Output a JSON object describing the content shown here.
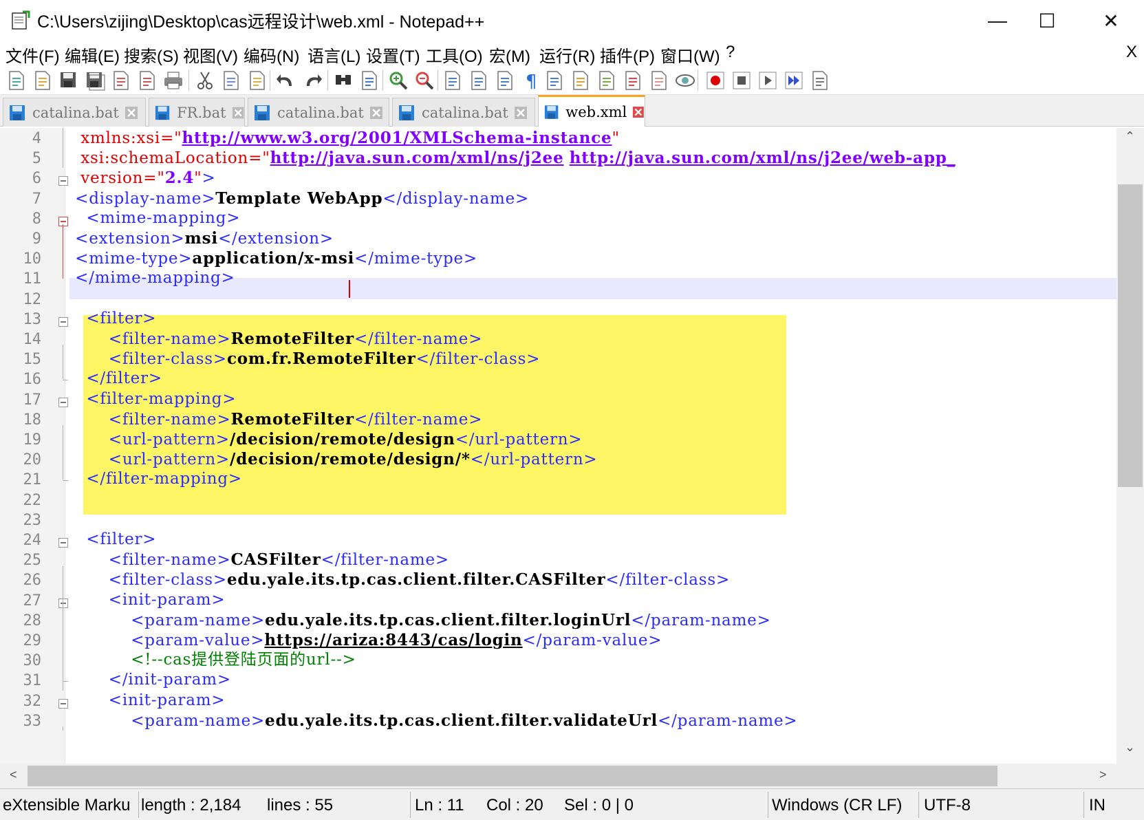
{
  "window": {
    "title": "C:\\Users\\zijing\\Desktop\\cas远程设计\\web.xml - Notepad++",
    "minimize_glyph": "—",
    "maximize_glyph": "☐",
    "close_glyph": "✕"
  },
  "menu": {
    "items": [
      "文件(F)",
      "编辑(E)",
      "搜索(S)",
      "视图(V)",
      "编码(N)",
      "语言(L)",
      "设置(T)",
      "工具(O)",
      "宏(M)",
      "运行(R)",
      "插件(P)",
      "窗口(W)",
      "?"
    ],
    "close_label": "X"
  },
  "toolbar": {
    "icons": [
      "new-file-icon",
      "open-file-icon",
      "save-icon",
      "save-all-icon",
      "close-icon",
      "close-all-icon",
      "print-icon",
      "cut-icon",
      "copy-icon",
      "paste-icon",
      "undo-icon",
      "redo-icon",
      "find-icon",
      "replace-icon",
      "zoom-in-icon",
      "zoom-out-icon",
      "sync-vertical-icon",
      "sync-horizontal-icon",
      "word-wrap-icon",
      "show-all-chars-icon",
      "indent-guide-icon",
      "udl-icon",
      "doc-map-icon",
      "function-list-icon",
      "folder-as-workspace-icon",
      "monitoring-icon",
      "record-macro-icon",
      "stop-macro-icon",
      "play-macro-icon",
      "run-macro-multiple-icon",
      "save-macro-icon"
    ]
  },
  "tabs": [
    {
      "label": "catalina.bat",
      "active": false
    },
    {
      "label": "FR.bat",
      "active": false
    },
    {
      "label": "catalina.bat",
      "active": false
    },
    {
      "label": "catalina.bat",
      "active": false
    },
    {
      "label": "web.xml",
      "active": true
    }
  ],
  "editor": {
    "line_numbers": [
      "4",
      "5",
      "6",
      "7",
      "8",
      "9",
      "10",
      "11",
      "12",
      "13",
      "14",
      "15",
      "16",
      "17",
      "18",
      "19",
      "20",
      "21",
      "22",
      "23",
      "24",
      "25",
      "26",
      "27",
      "28",
      "29",
      "30",
      "31",
      "32",
      "33"
    ],
    "lines": {
      "l4": {
        "indent": "  ",
        "a1": "xmlns:xsi",
        "eq": "=\"",
        "link": "http://www.w3.org/2001/XMLSchema-instance",
        "q": "\""
      },
      "l5": {
        "indent": "  ",
        "a1": "xsi:schemaLocation",
        "eq": "=\"",
        "link1": "http://java.sun.com/xml/ns/j2ee",
        "sp": " ",
        "link2": "http://java.sun.com/xml/ns/j2ee/web-app_"
      },
      "l6": {
        "indent": "  ",
        "a1": "version",
        "eq": "=\"",
        "val": "2.4",
        "q": "\"",
        "close": ">"
      },
      "l7": {
        "indent": " ",
        "open": "<display-name>",
        "text": "Template WebApp",
        "close": "</display-name>"
      },
      "l8": {
        "indent": "   ",
        "open": "<mime-mapping>"
      },
      "l9": {
        "indent": " ",
        "open": "<extension>",
        "text": "msi",
        "close": "</extension>"
      },
      "l10": {
        "indent": " ",
        "open": "<mime-type>",
        "text": "application/x-msi",
        "close": "</mime-type>"
      },
      "l11": {
        "indent": " ",
        "open": "</mime-mapping>"
      },
      "l13": {
        "indent": "   ",
        "open": "<filter>"
      },
      "l14": {
        "indent": "       ",
        "open": "<filter-name>",
        "text": "RemoteFilter",
        "close": "</filter-name>"
      },
      "l15": {
        "indent": "       ",
        "open": "<filter-class>",
        "text": "com.fr.RemoteFilter",
        "close": "</filter-class>"
      },
      "l16": {
        "indent": "   ",
        "open": "</filter>"
      },
      "l17": {
        "indent": "   ",
        "open": "<filter-mapping>"
      },
      "l18": {
        "indent": "       ",
        "open": "<filter-name>",
        "text": "RemoteFilter",
        "close": "</filter-name>"
      },
      "l19": {
        "indent": "       ",
        "open": "<url-pattern>",
        "text": "/decision/remote/design",
        "close": "</url-pattern>"
      },
      "l20": {
        "indent": "       ",
        "open": "<url-pattern>",
        "text": "/decision/remote/design/*",
        "close": "</url-pattern>"
      },
      "l21": {
        "indent": "   ",
        "open": "</filter-mapping>"
      },
      "l24": {
        "indent": "   ",
        "open": "<filter>"
      },
      "l25": {
        "indent": "       ",
        "open": "<filter-name>",
        "text": "CASFilter",
        "close": "</filter-name>"
      },
      "l26": {
        "indent": "       ",
        "open": "<filter-class>",
        "text": "edu.yale.its.tp.cas.client.filter.CASFilter",
        "close": "</filter-class>"
      },
      "l27": {
        "indent": "       ",
        "open": "<init-param>"
      },
      "l28": {
        "indent": "           ",
        "open": "<param-name>",
        "text": "edu.yale.its.tp.cas.client.filter.loginUrl",
        "close": "</param-name>"
      },
      "l29": {
        "indent": "           ",
        "open": "<param-value>",
        "text": "https://ariza:8443/cas/login",
        "close": "</param-value>"
      },
      "l30": {
        "indent": "           ",
        "comment": "<!--cas提供登陆页面的url-->"
      },
      "l31": {
        "indent": "       ",
        "open": "</init-param>"
      },
      "l32": {
        "indent": "       ",
        "open": "<init-param>"
      },
      "l33": {
        "indent": "           ",
        "open": "<param-name>",
        "text": "edu.yale.its.tp.cas.client.filter.validateUrl",
        "close": "</param-name>"
      }
    }
  },
  "scroll": {
    "up": "⌃",
    "down": "⌄",
    "left": "<",
    "right": ">"
  },
  "status": {
    "language": "eXtensible Marku",
    "length": "length : 2,184",
    "lines": "lines : 55",
    "ln": "Ln : 11",
    "col": "Col : 20",
    "sel": "Sel : 0 | 0",
    "eol": "Windows (CR LF)",
    "encoding": "UTF-8",
    "mode": "IN"
  }
}
